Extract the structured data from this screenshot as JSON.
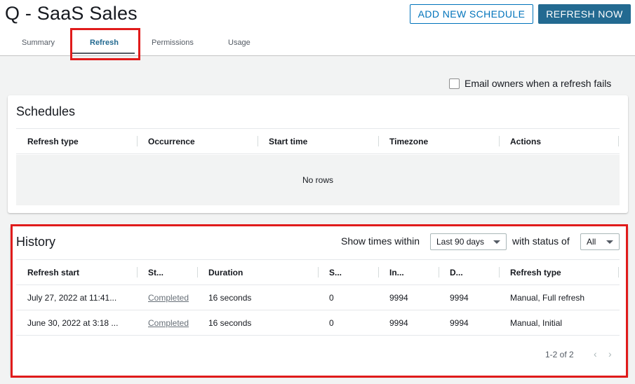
{
  "header": {
    "title": "Q - SaaS Sales",
    "add_schedule_label": "ADD NEW SCHEDULE",
    "refresh_now_label": "REFRESH NOW"
  },
  "tabs": [
    {
      "label": "Summary"
    },
    {
      "label": "Refresh",
      "active": true
    },
    {
      "label": "Permissions"
    },
    {
      "label": "Usage"
    }
  ],
  "email_option": {
    "label": "Email owners when a refresh fails",
    "checked": false
  },
  "schedules": {
    "title": "Schedules",
    "columns": [
      "Refresh type",
      "Occurrence",
      "Start time",
      "Timezone",
      "Actions"
    ],
    "empty_text": "No rows"
  },
  "history": {
    "title": "History",
    "filter_time_label": "Show times within",
    "filter_time_value": "Last 90 days",
    "filter_status_label": "with status of",
    "filter_status_value": "All",
    "columns": [
      "Refresh start",
      "St...",
      "Duration",
      "S...",
      "In...",
      "D...",
      "Refresh type"
    ],
    "rows": [
      [
        "July 27, 2022 at 11:41...",
        "Completed",
        "16 seconds",
        "0",
        "9994",
        "9994",
        "Manual, Full refresh"
      ],
      [
        "June 30, 2022 at 3:18 ...",
        "Completed",
        "16 seconds",
        "0",
        "9994",
        "9994",
        "Manual, Initial"
      ]
    ],
    "pagination": "1-2 of 2"
  },
  "icons": {
    "prev": "chevron-left-icon",
    "next": "chevron-right-icon",
    "dropdown": "caret-down-icon"
  },
  "colors": {
    "accent": "#0073bb",
    "primary_button": "#236a91",
    "highlight_border": "#e01b1b",
    "page_background": "#f2f3f3"
  }
}
